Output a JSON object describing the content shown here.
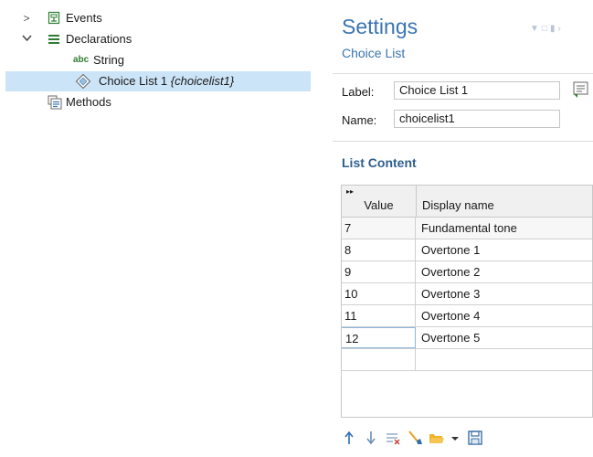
{
  "tree": {
    "events": {
      "label": "Events",
      "chevron": ">"
    },
    "declarations": {
      "label": "Declarations",
      "chevron": "v"
    },
    "string": {
      "label": "String",
      "icon_text": "abc"
    },
    "choice_list": {
      "label": "Choice List 1",
      "tag": "{choicelist1}"
    },
    "methods": {
      "label": "Methods"
    }
  },
  "settings": {
    "title": "Settings",
    "subtitle": "Choice List",
    "label_field": {
      "label": "Label:",
      "value": "Choice List 1"
    },
    "name_field": {
      "label": "Name:",
      "value": "choicelist1"
    },
    "section_title": "List Content",
    "table": {
      "header_mark": "▸▸",
      "columns": [
        "Value",
        "Display name"
      ],
      "rows": [
        {
          "value": "7",
          "display": "Fundamental tone"
        },
        {
          "value": "8",
          "display": "Overtone 1"
        },
        {
          "value": "9",
          "display": "Overtone 2"
        },
        {
          "value": "10",
          "display": "Overtone 3"
        },
        {
          "value": "11",
          "display": "Overtone 4"
        },
        {
          "value": "12",
          "display": "Overtone 5"
        },
        {
          "value": "",
          "display": ""
        }
      ]
    },
    "toolbar": [
      "move-up-icon",
      "move-down-icon",
      "clear-table-icon",
      "delete-icon",
      "load-from-file-icon",
      "dropdown-arrow-icon",
      "save-icon"
    ]
  },
  "colors": {
    "accent": "#3a75b0",
    "selection": "#cce4f7",
    "section": "#2f5f8f"
  }
}
